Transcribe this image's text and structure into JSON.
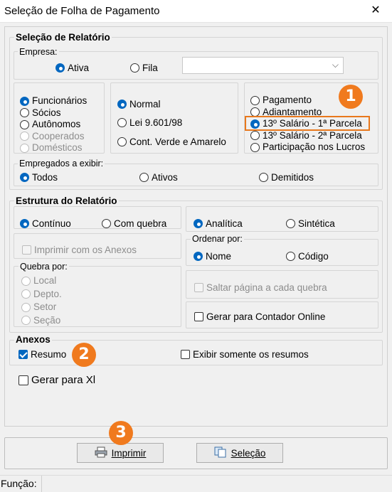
{
  "window": {
    "title": "Seleção de Folha de Pagamento",
    "close_icon": "close-icon"
  },
  "relatorio": {
    "legend": "Seleção de Relatório",
    "empresa": {
      "legend": "Empresa:",
      "ativa": "Ativa",
      "fila": "Fila",
      "combo_value": ""
    },
    "tipo_pessoa": [
      "Funcionários",
      "Sócios",
      "Autônomos",
      "Cooperados",
      "Domésticos"
    ],
    "regime": [
      "Normal",
      "Lei 9.601/98",
      "Cont. Verde e Amarelo"
    ],
    "tipo_folha": [
      "Pagamento",
      "Adiantamento",
      "13º Salário  -  1ª Parcela",
      "13º Salário  -  2ª Parcela",
      "Participação nos Lucros"
    ],
    "empregados": {
      "legend": "Empregados a exibir:",
      "todos": "Todos",
      "ativos": "Ativos",
      "demitidos": "Demitidos"
    }
  },
  "estrutura": {
    "legend": "Estrutura do Relatório",
    "continuo": "Contínuo",
    "com_quebra": "Com quebra",
    "imprimir_anexos": "Imprimir com os Anexos",
    "quebra_legend": "Quebra por:",
    "quebra": [
      "Local",
      "Depto.",
      "Setor",
      "Seção"
    ],
    "analitica": "Analítica",
    "sintetica": "Sintética",
    "ordenar_legend": "Ordenar por:",
    "nome": "Nome",
    "codigo": "Código",
    "saltar_pagina": "Saltar página a cada quebra",
    "gerar_contador": "Gerar para Contador Online"
  },
  "anexos": {
    "legend": "Anexos",
    "resumo": "Resumo",
    "exibir_resumos": "Exibir somente os resumos"
  },
  "gerar_xl": "Gerar para Xl",
  "buttons": {
    "imprimir": "Imprimir",
    "selecao": "Seleção"
  },
  "badges": [
    "1",
    "2",
    "3"
  ],
  "status": {
    "funcao": "Função:"
  },
  "colors": {
    "accent": "#0067c0",
    "highlight": "#e8781c",
    "badge": "#f07a1e"
  }
}
